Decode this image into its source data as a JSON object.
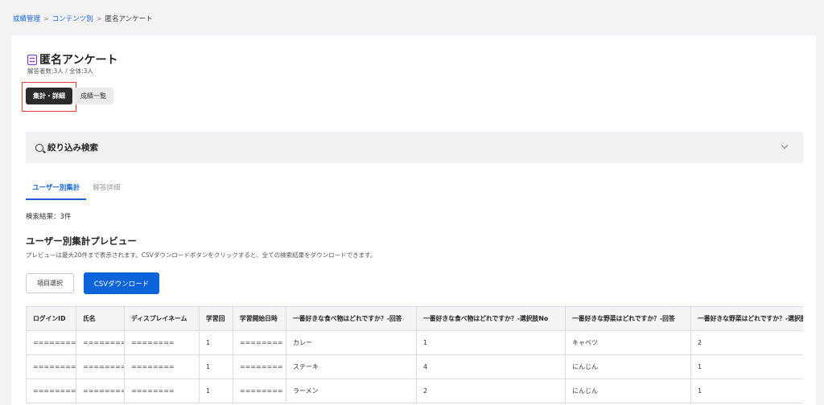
{
  "breadcrumb": {
    "items": [
      "成績管理",
      "コンテンツ別"
    ],
    "separator": ">",
    "current": "匿名アンケート"
  },
  "page": {
    "title": "匿名アンケート",
    "title_icon": "document-list-icon",
    "meta": "解答者数:3人 / 全体:3人"
  },
  "view_toggle": {
    "summary_label": "集計・詳細",
    "grades_label": "成績一覧"
  },
  "filter": {
    "label": "絞り込み検索",
    "icon": "search-icon"
  },
  "tabs": [
    {
      "label": "ユーザー別集計",
      "active": true
    },
    {
      "label": "解答詳細",
      "active": false
    }
  ],
  "result_count": "検索結果：3件",
  "section": {
    "title": "ユーザー別集計プレビュー",
    "description": "プレビューは最大20件まで表示されます。CSVダウンロードボタンをクリックすると、全ての検索結果をダウンロードできます。"
  },
  "actions": {
    "select_items": "項目選択",
    "csv_download": "CSVダウンロード"
  },
  "colors": {
    "primary": "#0a63d8",
    "link": "#1a66d9",
    "dark_button": "#2b2b2b",
    "highlight_border": "#e23b3b"
  },
  "table": {
    "headers": [
      "ログインID",
      "氏名",
      "ディスプレイネーム",
      "学習回",
      "学習開始日時",
      "一番好きな食べ物はどれですか？-回答",
      "一番好きな食べ物はどれですか？-選択肢No",
      "一番好きな野菜はどれですか？-回答",
      "一番好きな野菜はどれですか？-選択肢No"
    ],
    "rows": [
      [
        "========",
        "========",
        "========",
        "1",
        "========",
        "カレー",
        "1",
        "キャベツ",
        "2"
      ],
      [
        "========",
        "========",
        "========",
        "1",
        "========",
        "ステーキ",
        "4",
        "にんじん",
        "1"
      ],
      [
        "========",
        "========",
        "========",
        "1",
        "========",
        "ラーメン",
        "2",
        "にんじん",
        "1"
      ]
    ]
  }
}
